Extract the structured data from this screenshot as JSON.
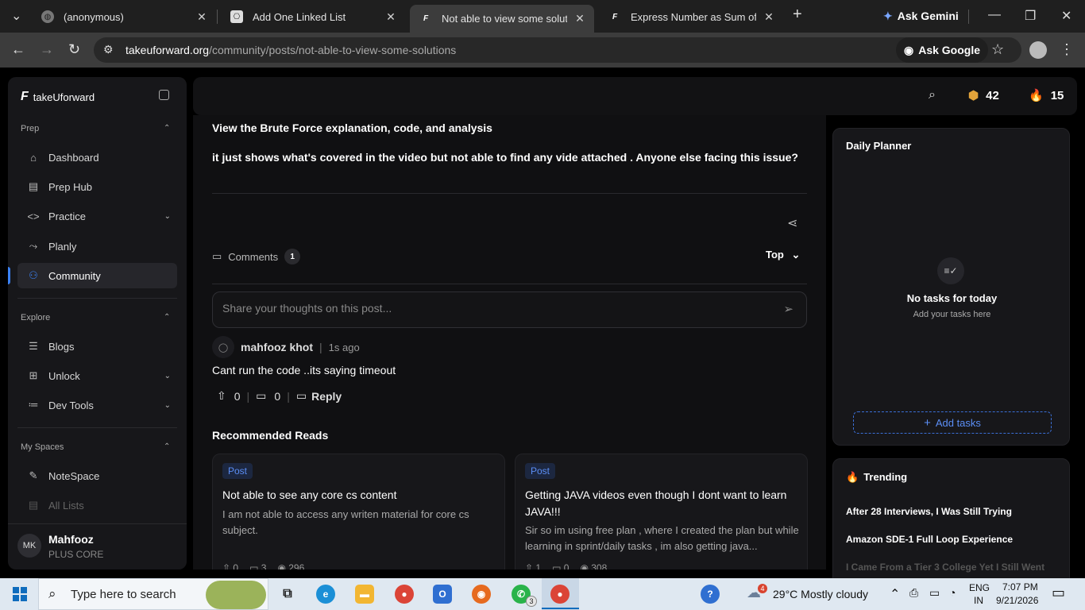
{
  "browser": {
    "tabs": [
      {
        "title": "(anonymous)",
        "active": false
      },
      {
        "title": "Add One Linked List",
        "active": false
      },
      {
        "title": "Not able to view some solutions",
        "active": true
      },
      {
        "title": "Express Number as Sum of Two",
        "active": false
      }
    ],
    "ask_gemini": "Ask Gemini",
    "url_domain": "takeuforward.org",
    "url_path": "/community/posts/not-able-to-view-some-solutions",
    "ask_google": "Ask Google"
  },
  "sidebar": {
    "brand": "takeUforward",
    "prep_label": "Prep",
    "prep_items": [
      {
        "label": "Dashboard",
        "icon": "home-icon"
      },
      {
        "label": "Prep Hub",
        "icon": "document-icon"
      },
      {
        "label": "Practice",
        "icon": "code-icon"
      },
      {
        "label": "Planly",
        "icon": "route-icon"
      },
      {
        "label": "Community",
        "icon": "users-icon"
      }
    ],
    "explore_label": "Explore",
    "explore_items": [
      {
        "label": "Blogs",
        "icon": "newspaper-icon"
      },
      {
        "label": "Unlock",
        "icon": "gift-icon"
      },
      {
        "label": "Dev Tools",
        "icon": "tools-icon"
      }
    ],
    "spaces_label": "My Spaces",
    "spaces_items": [
      {
        "label": "NoteSpace",
        "icon": "pen-icon"
      },
      {
        "label": "All Lists",
        "icon": "list-icon"
      }
    ],
    "user": {
      "initials": "MK",
      "name": "Mahfooz",
      "plan": "PLUS CORE"
    }
  },
  "topbar": {
    "coins": "42",
    "streak": "15"
  },
  "post": {
    "line1": "View the Brute Force explanation, code, and analysis",
    "line2": "it just shows what's covered in the video but not able to find any vide attached . Anyone else facing this issue?"
  },
  "comments": {
    "label": "Comments",
    "count": "1",
    "sort": "Top",
    "placeholder": "Share your thoughts on this post...",
    "items": [
      {
        "author": "mahfooz khot",
        "time": "1s ago",
        "body": "Cant run the code ..its saying timeout",
        "upvotes": "0",
        "replies": "0",
        "reply_label": "Reply"
      }
    ]
  },
  "recommended": {
    "title": "Recommended Reads",
    "cards": [
      {
        "tag": "Post",
        "title": "Not able to see any core cs content",
        "desc": "I am not able to access any writen material for core cs subject.",
        "votes": "0",
        "comments": "3",
        "views": "296"
      },
      {
        "tag": "Post",
        "title": "Getting JAVA videos even though I dont want to learn JAVA!!!",
        "desc": "Sir so im using free plan , where I created the plan but while learning in sprint/daily tasks , im also getting java...",
        "votes": "1",
        "comments": "0",
        "views": "308"
      }
    ]
  },
  "planner": {
    "title": "Daily Planner",
    "empty": "No tasks for today",
    "sub": "Add your tasks here",
    "add": "Add tasks"
  },
  "trending": {
    "title": "Trending",
    "items": [
      "After 28 Interviews, I Was Still Trying",
      "Amazon SDE-1 Full Loop Experience",
      "I Came From a Tier 3 College Yet I Still Went"
    ]
  },
  "taskbar": {
    "search": "Type here to search",
    "whatsapp_badge": "3",
    "weather_badge": "4",
    "weather": "29°C  Mostly cloudy",
    "lang": "ENG",
    "region": "IN",
    "time": "7:07 PM",
    "date": "9/21/2026"
  }
}
